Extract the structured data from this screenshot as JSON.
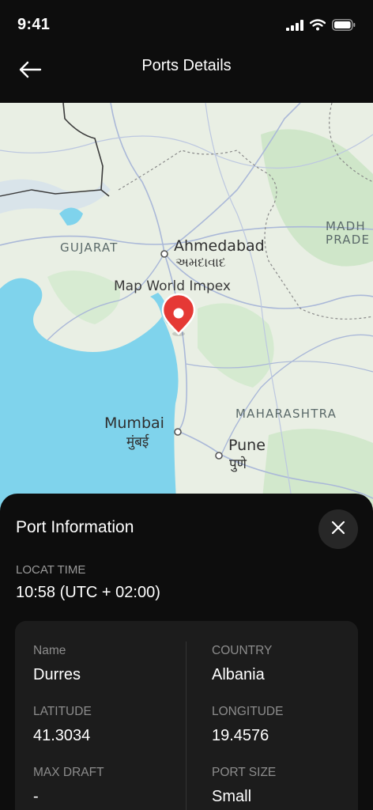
{
  "status_bar": {
    "time": "9:41"
  },
  "header": {
    "title": "Ports Details"
  },
  "map": {
    "labels": {
      "gujarat": "GUJARAT",
      "ahmedabad": "Ahmedabad",
      "ahmedabad_local": "અમદાવાદ",
      "map_world": "Map World Impex",
      "madhya": "MADH",
      "madhya_line2": "PRADE",
      "maharashtra": "MAHARASHTRA",
      "mumbai": "Mumbai",
      "mumbai_local": "मुंबई",
      "pune": "Pune",
      "pune_local": "पुणे"
    },
    "marker_icon": "map-pin-icon",
    "colors": {
      "sea": "#7fd3ec",
      "land": "#e9efe4",
      "marker": "#e53935"
    }
  },
  "sheet": {
    "title": "Port Information",
    "time_label": "LOCAT TIME",
    "time_value": "10:58 (UTC + 02:00)",
    "close_icon": "close-icon",
    "fields": {
      "name": {
        "label": "Name",
        "value": "Durres"
      },
      "country": {
        "label": "COUNTRY",
        "value": "Albania"
      },
      "latitude": {
        "label": "LATITUDE",
        "value": "41.3034"
      },
      "longitude": {
        "label": "LONGITUDE",
        "value": "19.4576"
      },
      "max_draft": {
        "label": "MAX DRAFT",
        "value": "-"
      },
      "port_size": {
        "label": "PORT SIZE",
        "value": "Small"
      }
    }
  }
}
